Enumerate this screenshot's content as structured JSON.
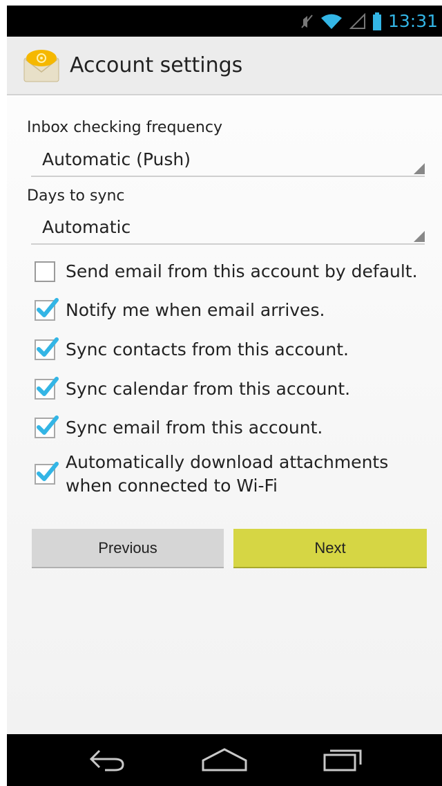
{
  "status_bar": {
    "time": "13:31",
    "icons": [
      "mute-icon",
      "wifi-icon",
      "signal-icon",
      "battery-icon"
    ],
    "clock_color": "#33b5e5"
  },
  "action_bar": {
    "title": "Account settings",
    "icon": "email-app-icon"
  },
  "settings": {
    "inbox_frequency": {
      "label": "Inbox checking frequency",
      "value": "Automatic (Push)"
    },
    "days_to_sync": {
      "label": "Days to sync",
      "value": "Automatic"
    },
    "checkboxes": [
      {
        "label": "Send email from this account by default.",
        "checked": false
      },
      {
        "label": "Notify me when email arrives.",
        "checked": true
      },
      {
        "label": "Sync contacts from this account.",
        "checked": true
      },
      {
        "label": "Sync calendar from this account.",
        "checked": true
      },
      {
        "label": "Sync email from this account.",
        "checked": true
      },
      {
        "label_line1": "Automatically download attachments",
        "label_line2": "when connected to Wi-Fi",
        "checked": true
      }
    ]
  },
  "buttons": {
    "previous": "Previous",
    "next": "Next"
  },
  "nav_bar": {
    "icons": [
      "back-icon",
      "home-icon",
      "recents-icon"
    ]
  },
  "colors": {
    "accent": "#33b5e5",
    "next_button": "#d6d644",
    "previous_button": "#d6d6d6"
  }
}
